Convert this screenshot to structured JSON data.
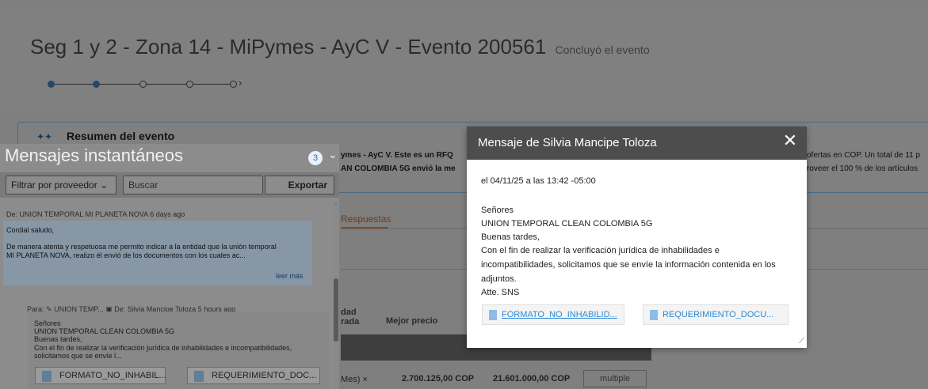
{
  "event": {
    "title": "Seg 1 y 2 - Zona 14 - MiPymes - AyC V - Evento 200561",
    "status": "Concluyó el evento"
  },
  "summary": {
    "title": "Resumen del evento",
    "snippet_left_1": "ymes - AyC V. Este es un RFQ",
    "snippet_left_2": "AN COLOMBIA 5G envió la me",
    "snippet_right_1": "ofertas en COP. Un total de 11 p",
    "snippet_right_2": "roveer el 100 % de los artículos"
  },
  "tabs": {
    "responses": "Respuestas"
  },
  "table": {
    "col_dad": "dad",
    "col_rada": "rada",
    "col_best_price": "Mejor precio",
    "row": {
      "unit": "Mes) ×",
      "best_price": "2.700.125,00 COP",
      "total": "21.601.000,00 COP",
      "multiple": "multiple"
    }
  },
  "im": {
    "title": "Mensajes instantáneos",
    "badge": "3",
    "filter": "Filtrar por proveedor",
    "search_placeholder": "Buscar",
    "export": "Exportar",
    "msg1": {
      "from": "De: UNION TEMPORAL MI PLANETA NOVA 6 days ago",
      "line1": "Cordial saludo,",
      "line2": "De manera atenta y respetuosa me permito indicar a la entidad que la unión temporal",
      "line3": "MI PLANETA NOVA, realizo él envió de los documentos con los cuales ac...",
      "more": "leer más"
    },
    "msg2": {
      "to": "Para:",
      "to_name": "UNION TEMP...",
      "from": "De: Silvia Mancipe Toloza 5 hours ago",
      "line1": "Señores",
      "line2": "UNION TEMPORAL CLEAN COLOMBIA 5G",
      "line3": "Buenas tardes,",
      "line4": "Con el fin de realizar la verificación jurídica de inhabilidades e incompatibilidades,",
      "line5": "solicitamos que se envíe l...",
      "att1": "FORMATO_NO_INHABIL...",
      "att2": "REQUERIMIENTO_DOC..."
    }
  },
  "modal": {
    "title": "Mensaje de Silvia Mancipe Toloza",
    "date": "el 04/11/25 a las 13:42 -05:00",
    "lines": [
      "Señores",
      "UNION TEMPORAL CLEAN COLOMBIA 5G",
      "Buenas tardes,",
      "Con el fin de realizar la verificación jurídica de inhabilidades e",
      "incompatibilidades, solicitamos que se envíe la información contenida en los",
      "adjuntos.",
      "Atte. SNS"
    ],
    "att1": "FORMATO_NO_INHABILID...",
    "att2": "REQUERIMIENTO_DOCU..."
  }
}
